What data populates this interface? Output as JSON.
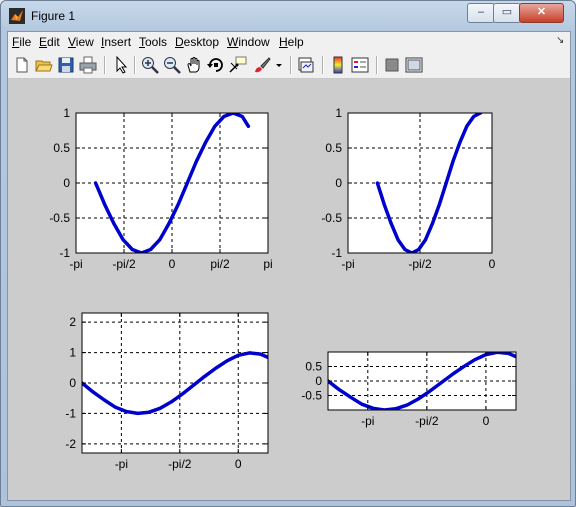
{
  "window": {
    "title": "Figure 1",
    "minimize": "‒",
    "maximize": "▭",
    "close": "✕"
  },
  "menu": [
    {
      "u": "F",
      "rest": "ile"
    },
    {
      "u": "E",
      "rest": "dit"
    },
    {
      "u": "V",
      "rest": "iew"
    },
    {
      "u": "I",
      "rest": "nsert"
    },
    {
      "u": "T",
      "rest": "ools"
    },
    {
      "u": "D",
      "rest": "esktop"
    },
    {
      "u": "W",
      "rest": "indow"
    },
    {
      "u": "H",
      "rest": "elp"
    }
  ],
  "toolbar_icons": [
    "new-figure-icon",
    "open-icon",
    "save-icon",
    "print-icon",
    "pointer-icon",
    "zoom-in-icon",
    "zoom-out-icon",
    "pan-hand-icon",
    "rotate-3d-icon",
    "data-cursor-icon",
    "brush-icon",
    "brush-dropdown-icon",
    "link-plot-icon",
    "colorbar-icon",
    "legend-icon",
    "hide-plot-tools-icon",
    "show-plot-tools-icon"
  ],
  "colors": {
    "line": "#0000cc",
    "figure_bg": "#cccccc",
    "axes_bg": "#ffffff"
  },
  "chart_data": [
    {
      "type": "line",
      "position": "top-left",
      "xlim": [
        -3.1416,
        3.1416
      ],
      "ylim": [
        -1,
        1
      ],
      "xticks": [
        {
          "v": -3.1416,
          "label": "-pi"
        },
        {
          "v": -1.5708,
          "label": "-pi/2"
        },
        {
          "v": 0,
          "label": "0"
        },
        {
          "v": 1.5708,
          "label": "pi/2"
        },
        {
          "v": 3.1416,
          "label": "pi"
        }
      ],
      "yticks": [
        {
          "v": -1,
          "label": "-1"
        },
        {
          "v": -0.5,
          "label": "-0.5"
        },
        {
          "v": 0,
          "label": "0"
        },
        {
          "v": 0.5,
          "label": "0.5"
        },
        {
          "v": 1,
          "label": "1"
        }
      ],
      "grid": true,
      "series": [
        {
          "x": [
            -2.5,
            -2.2,
            -1.9,
            -1.6,
            -1.3,
            -1.0,
            -0.7,
            -0.4,
            -0.1,
            0.2,
            0.5,
            0.8,
            1.1,
            1.4,
            1.7,
            2.0,
            2.3,
            2.5
          ],
          "y": [
            0.0,
            -0.31,
            -0.58,
            -0.81,
            -0.95,
            -1.0,
            -0.95,
            -0.81,
            -0.58,
            -0.31,
            0.0,
            0.31,
            0.58,
            0.81,
            0.95,
            1.0,
            0.95,
            0.81
          ]
        }
      ]
    },
    {
      "type": "line",
      "position": "top-right",
      "xlim": [
        -3.1416,
        0
      ],
      "ylim": [
        -1,
        1
      ],
      "xticks": [
        {
          "v": -3.1416,
          "label": "-pi"
        },
        {
          "v": -1.5708,
          "label": "-pi/2"
        },
        {
          "v": 0,
          "label": "0"
        }
      ],
      "yticks": [
        {
          "v": -1,
          "label": "-1"
        },
        {
          "v": -0.5,
          "label": "-0.5"
        },
        {
          "v": 0,
          "label": "0"
        },
        {
          "v": 0.5,
          "label": "0.5"
        },
        {
          "v": 1,
          "label": "1"
        }
      ],
      "grid": true,
      "series": [
        {
          "x": [
            -2.5,
            -2.35,
            -2.2,
            -2.05,
            -1.9,
            -1.75,
            -1.6,
            -1.45,
            -1.3,
            -1.15,
            -1.0,
            -0.85,
            -0.7,
            -0.55,
            -0.4,
            -0.25
          ],
          "y": [
            0.0,
            -0.31,
            -0.58,
            -0.81,
            -0.95,
            -1.0,
            -0.95,
            -0.81,
            -0.58,
            -0.31,
            0.0,
            0.31,
            0.58,
            0.81,
            0.95,
            1.0
          ]
        }
      ]
    },
    {
      "type": "line",
      "position": "bottom-left",
      "xlim": [
        -4.2,
        0.8
      ],
      "ylim": [
        -2.3,
        2.3
      ],
      "xticks": [
        {
          "v": -3.1416,
          "label": "-pi"
        },
        {
          "v": -1.5708,
          "label": "-pi/2"
        },
        {
          "v": 0,
          "label": "0"
        }
      ],
      "yticks": [
        {
          "v": -2,
          "label": "-2"
        },
        {
          "v": -1,
          "label": "-1"
        },
        {
          "v": 0,
          "label": "0"
        },
        {
          "v": 1,
          "label": "1"
        },
        {
          "v": 2,
          "label": "2"
        }
      ],
      "grid": true,
      "series": [
        {
          "x": [
            -4.2,
            -3.9,
            -3.6,
            -3.3,
            -3.0,
            -2.7,
            -2.4,
            -2.1,
            -1.8,
            -1.5,
            -1.2,
            -0.9,
            -0.6,
            -0.3,
            0.0,
            0.3,
            0.6,
            0.8
          ],
          "y": [
            0.0,
            -0.3,
            -0.56,
            -0.8,
            -0.94,
            -1.0,
            -0.96,
            -0.83,
            -0.62,
            -0.36,
            -0.07,
            0.22,
            0.49,
            0.73,
            0.91,
            0.99,
            0.95,
            0.84
          ]
        }
      ]
    },
    {
      "type": "line",
      "position": "bottom-right",
      "xlim": [
        -4.2,
        0.8
      ],
      "ylim": [
        -1.0,
        1.0
      ],
      "xticks": [
        {
          "v": -3.1416,
          "label": "-pi"
        },
        {
          "v": -1.5708,
          "label": "-pi/2"
        },
        {
          "v": 0,
          "label": "0"
        }
      ],
      "yticks": [
        {
          "v": -0.5,
          "label": "-0.5"
        },
        {
          "v": 0,
          "label": "0"
        },
        {
          "v": 0.5,
          "label": "0.5"
        }
      ],
      "grid": true,
      "series": [
        {
          "x": [
            -4.2,
            -3.9,
            -3.6,
            -3.3,
            -3.0,
            -2.7,
            -2.4,
            -2.1,
            -1.8,
            -1.5,
            -1.2,
            -0.9,
            -0.6,
            -0.3,
            0.0,
            0.3,
            0.6,
            0.8
          ],
          "y": [
            0.0,
            -0.3,
            -0.56,
            -0.8,
            -0.94,
            -1.0,
            -0.96,
            -0.83,
            -0.62,
            -0.36,
            -0.07,
            0.22,
            0.49,
            0.73,
            0.91,
            0.99,
            0.95,
            0.84
          ]
        }
      ]
    }
  ]
}
